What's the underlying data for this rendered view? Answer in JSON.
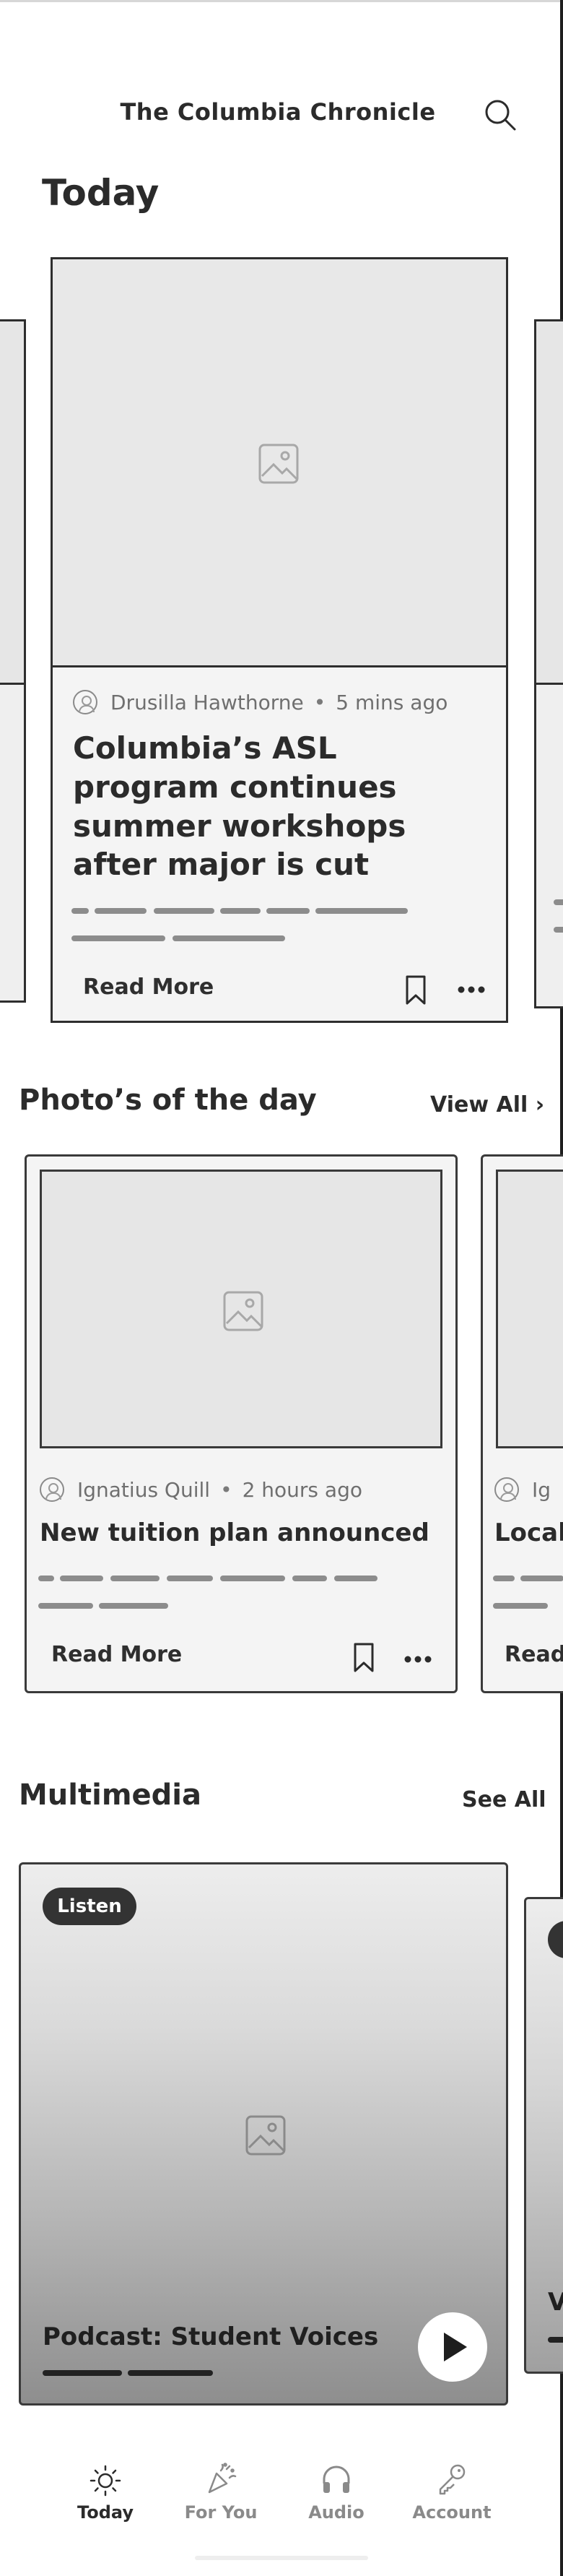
{
  "header": {
    "title": "The Columbia Chronicle",
    "search_icon": "search-icon"
  },
  "today": {
    "section_title": "Today",
    "featured": {
      "author": "Drusilla Hawthorne",
      "time": "5 mins ago",
      "headline": "Columbia’s ASL program continues summer workshops after major is cut",
      "read_more": "Read More",
      "bookmark_icon": "bookmark-icon",
      "more_icon": "more-options-icon"
    }
  },
  "photos": {
    "section_title": "Photo’s of the day",
    "view_all": "View All ›",
    "cards": [
      {
        "author": "Ignatius Quill",
        "time": "2 hours ago",
        "headline": "New tuition plan announced",
        "read_more": "Read More"
      },
      {
        "author": "Ig",
        "headline": "Local",
        "read_more": "Read"
      }
    ]
  },
  "multimedia": {
    "section_title": "Multimedia",
    "see_all": "See All",
    "card": {
      "badge": "Listen",
      "title": "Podcast: Student Voices",
      "play_icon": "play-icon"
    },
    "peek_letter": "V"
  },
  "nav": {
    "items": [
      {
        "label": "Today",
        "icon": "sun-icon",
        "active": true
      },
      {
        "label": "For You",
        "icon": "party-popper-icon",
        "active": false
      },
      {
        "label": "Audio",
        "icon": "headphones-icon",
        "active": false
      },
      {
        "label": "Account",
        "icon": "key-icon",
        "active": false
      }
    ]
  },
  "colors": {
    "ink": "#2b2b2b",
    "muted": "#8a8a8a",
    "card_bg": "#f4f4f4",
    "badge_bg": "#333333"
  }
}
